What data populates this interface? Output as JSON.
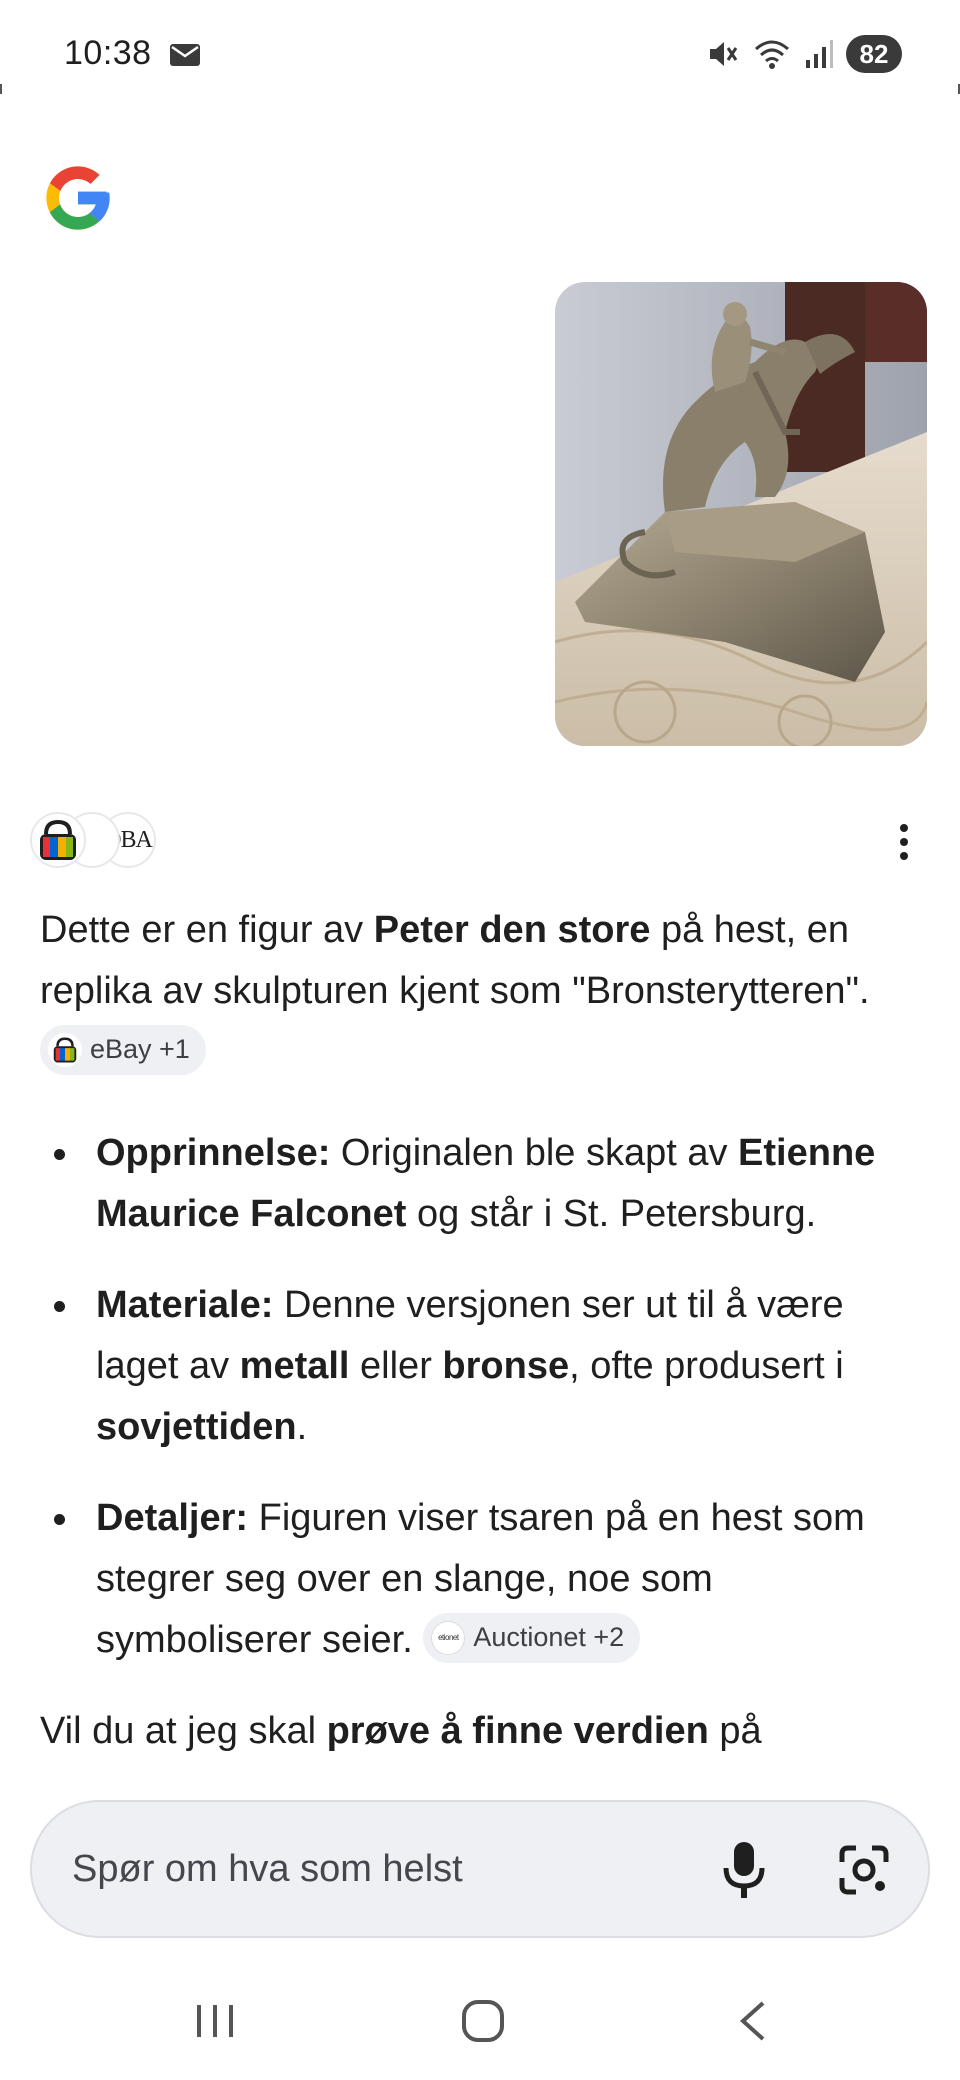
{
  "status_bar": {
    "time": "10:38",
    "battery": "82",
    "icons": [
      "mail-icon",
      "mute-icon",
      "wifi-icon",
      "signal-icon"
    ]
  },
  "assistant": {
    "logo": "google-g-logo",
    "sources": [
      "ebay-logo",
      "blank-source",
      "dba-logo"
    ],
    "dba_label": "DBA"
  },
  "answer": {
    "intro_1": "Dette er en figur av ",
    "intro_bold": "Peter den store",
    "intro_2": " på hest, en replika av skulpturen kjent som \"Bronsterytteren\". ",
    "chip_1": "eBay +1",
    "bullets": [
      {
        "label": "Opprinnelse:",
        "t1": " Originalen ble skapt av ",
        "b1": "Etienne Maurice Falconet",
        "t2": " og står i St. Petersburg."
      },
      {
        "label": "Materiale:",
        "t1": " Denne versjonen ser ut til å være laget av ",
        "b1": "metall",
        "t2": " eller ",
        "b2": "bronse",
        "t3": ", ofte produsert i ",
        "b3": "sovjettiden",
        "t4": "."
      },
      {
        "label": "Detaljer:",
        "t1": " Figuren viser tsaren på en hest som stegrer seg over en slange, noe som symboliserer seier. ",
        "chip": "Auctionet +2",
        "chip_icon_text": "etionet"
      }
    ],
    "final_1": "Vil du at jeg skal ",
    "final_bold": "prøve å finne verdien",
    "final_2": " på"
  },
  "input": {
    "placeholder": "Spør om hva som helst"
  },
  "colors": {
    "accent_blue": "#4285F4",
    "accent_red": "#EA4335",
    "accent_yellow": "#FBBC05",
    "accent_green": "#34A853",
    "chip_bg": "#eef0f4"
  }
}
